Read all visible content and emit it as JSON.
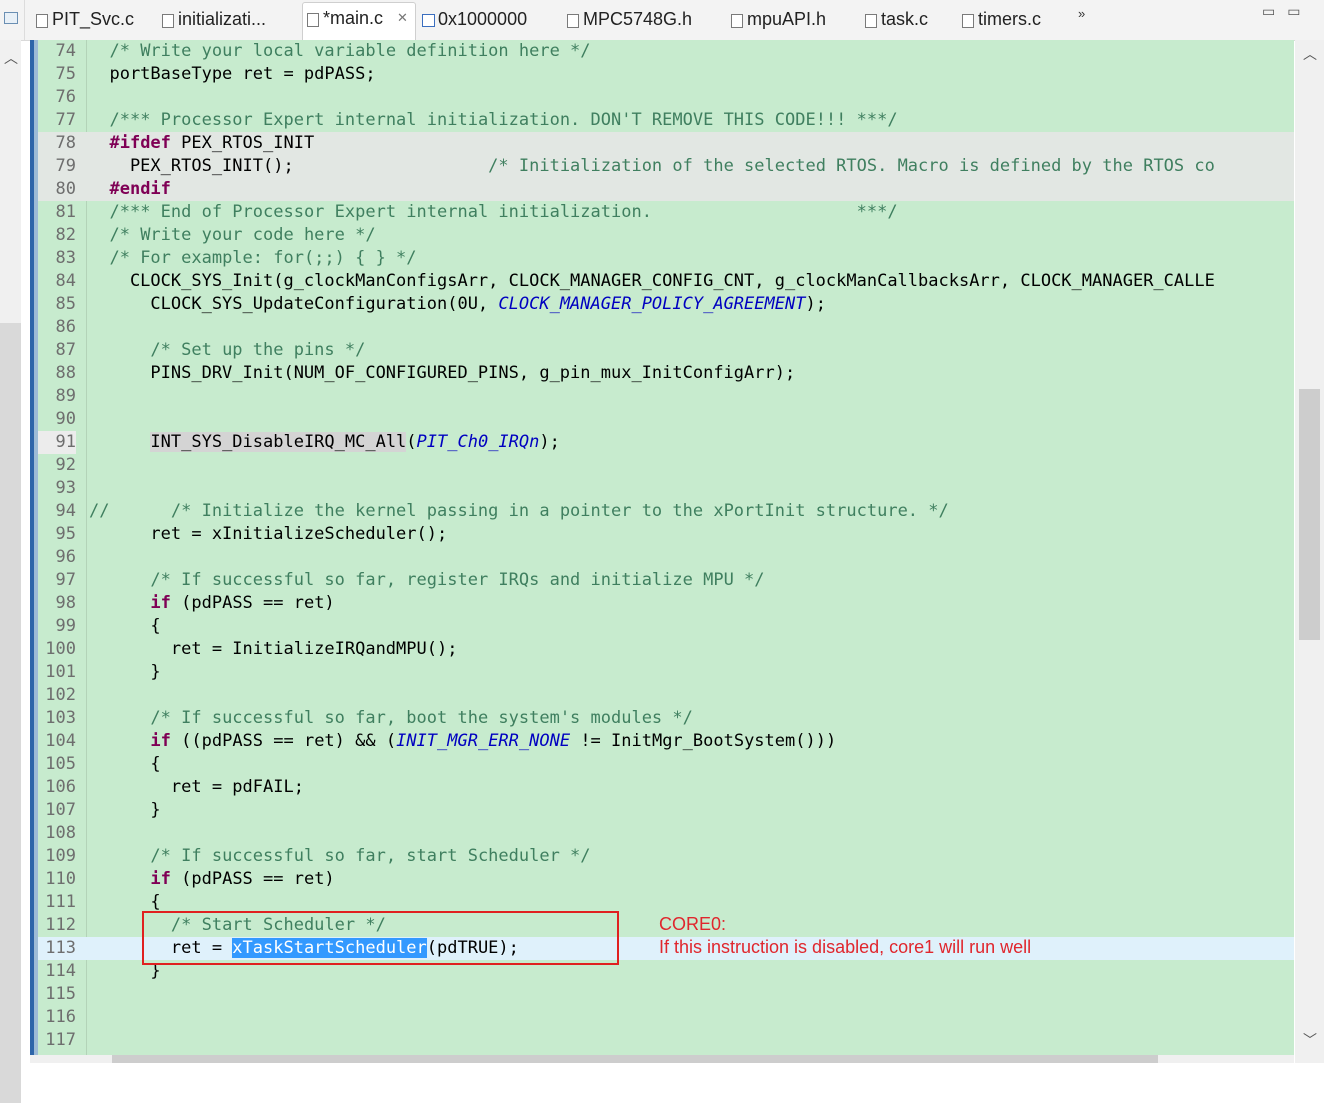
{
  "tabs": [
    {
      "label": "PIT_Svc.c",
      "icon": "c-file-icon",
      "active": false
    },
    {
      "label": "initializati...",
      "icon": "c-file-icon",
      "active": false
    },
    {
      "label": "*main.c",
      "icon": "c-file-icon",
      "active": true
    },
    {
      "label": "0x1000000",
      "icon": "memory-icon",
      "active": false
    },
    {
      "label": "MPC5748G.h",
      "icon": "h-file-icon",
      "active": false
    },
    {
      "label": "mpuAPI.h",
      "icon": "h-file-icon",
      "active": false
    },
    {
      "label": "task.c",
      "icon": "c-file-icon",
      "active": false
    },
    {
      "label": "timers.c",
      "icon": "c-file-icon",
      "active": false
    }
  ],
  "overflow_chevron": "»",
  "colors": {
    "editor_bg": "#c7ebce",
    "comment": "#3f7f5f",
    "keyword": "#7f0055",
    "enum": "#0000c0",
    "selection": "#3399ff",
    "annotation": "#e0262d"
  },
  "annotation": {
    "title": "CORE0:",
    "text": "If this instruction is disabled, core1 will run well"
  },
  "code_lines": [
    {
      "n": "74",
      "segs": [
        [
          "  ",
          ""
        ],
        [
          "/* Write your local variable definition here */",
          "com"
        ]
      ]
    },
    {
      "n": "75",
      "segs": [
        [
          "  portBaseType ret = pdPASS;",
          ""
        ]
      ]
    },
    {
      "n": "76",
      "segs": [
        [
          "",
          ""
        ]
      ]
    },
    {
      "n": "77",
      "segs": [
        [
          "  ",
          ""
        ],
        [
          "/*** Processor Expert internal initialization. DON'T REMOVE THIS CODE!!! ***/",
          "com"
        ]
      ]
    },
    {
      "n": "78",
      "hl": true,
      "segs": [
        [
          "  ",
          ""
        ],
        [
          "#ifdef",
          "kw"
        ],
        [
          " PEX_RTOS_INIT",
          ""
        ]
      ]
    },
    {
      "n": "79",
      "hl": true,
      "segs": [
        [
          "    PEX_RTOS_INIT();                   ",
          ""
        ],
        [
          "/* Initialization of the selected RTOS. Macro is defined by the RTOS co",
          "com"
        ]
      ]
    },
    {
      "n": "80",
      "hl": true,
      "segs": [
        [
          "  ",
          ""
        ],
        [
          "#endif",
          "kw"
        ]
      ]
    },
    {
      "n": "81",
      "segs": [
        [
          "  ",
          ""
        ],
        [
          "/*** End of Processor Expert internal initialization.                    ***/",
          "com"
        ]
      ]
    },
    {
      "n": "82",
      "segs": [
        [
          "  ",
          ""
        ],
        [
          "/* Write your code here */",
          "com"
        ]
      ]
    },
    {
      "n": "83",
      "segs": [
        [
          "  ",
          ""
        ],
        [
          "/* For example: for(;;) { } */",
          "com"
        ]
      ]
    },
    {
      "n": "84",
      "segs": [
        [
          "    CLOCK_SYS_Init(g_clockManConfigsArr, CLOCK_MANAGER_CONFIG_CNT, g_clockManCallbacksArr, CLOCK_MANAGER_CALLE",
          ""
        ]
      ]
    },
    {
      "n": "85",
      "segs": [
        [
          "      CLOCK_SYS_UpdateConfiguration(0U, ",
          ""
        ],
        [
          "CLOCK_MANAGER_POLICY_AGREEMENT",
          "en"
        ],
        [
          ");",
          ""
        ]
      ]
    },
    {
      "n": "86",
      "segs": [
        [
          "",
          ""
        ]
      ]
    },
    {
      "n": "87",
      "segs": [
        [
          "      ",
          ""
        ],
        [
          "/* Set up the pins */",
          "com"
        ]
      ]
    },
    {
      "n": "88",
      "segs": [
        [
          "      PINS_DRV_Init(NUM_OF_CONFIGURED_PINS, g_pin_mux_InitConfigArr);",
          ""
        ]
      ]
    },
    {
      "n": "89",
      "segs": [
        [
          "",
          ""
        ]
      ]
    },
    {
      "n": "90",
      "segs": [
        [
          "",
          ""
        ]
      ]
    },
    {
      "n": "91",
      "lnsel": true,
      "segs": [
        [
          "      ",
          ""
        ],
        [
          "INT_SYS_DisableIRQ_MC_All",
          "mark"
        ],
        [
          "(",
          ""
        ],
        [
          "PIT_Ch0_IRQn",
          "en"
        ],
        [
          ");",
          ""
        ]
      ]
    },
    {
      "n": "92",
      "segs": [
        [
          "",
          ""
        ]
      ]
    },
    {
      "n": "93",
      "segs": [
        [
          "",
          ""
        ]
      ]
    },
    {
      "n": "94",
      "segs": [
        [
          "//      ",
          "com"
        ],
        [
          "/* Initialize the kernel passing in a pointer to the xPortInit structure. */",
          "com"
        ]
      ]
    },
    {
      "n": "95",
      "segs": [
        [
          "      ret = xInitializeScheduler();",
          ""
        ]
      ]
    },
    {
      "n": "96",
      "segs": [
        [
          "",
          ""
        ]
      ]
    },
    {
      "n": "97",
      "segs": [
        [
          "      ",
          ""
        ],
        [
          "/* If successful so far, register IRQs and initialize MPU */",
          "com"
        ]
      ]
    },
    {
      "n": "98",
      "segs": [
        [
          "      ",
          ""
        ],
        [
          "if",
          "kw"
        ],
        [
          " (pdPASS == ret)",
          ""
        ]
      ]
    },
    {
      "n": "99",
      "segs": [
        [
          "      {",
          ""
        ]
      ]
    },
    {
      "n": "100",
      "segs": [
        [
          "        ret = InitializeIRQandMPU();",
          ""
        ]
      ]
    },
    {
      "n": "101",
      "segs": [
        [
          "      }",
          ""
        ]
      ]
    },
    {
      "n": "102",
      "segs": [
        [
          "",
          ""
        ]
      ]
    },
    {
      "n": "103",
      "segs": [
        [
          "      ",
          ""
        ],
        [
          "/* If successful so far, boot the system's modules */",
          "com"
        ]
      ]
    },
    {
      "n": "104",
      "segs": [
        [
          "      ",
          ""
        ],
        [
          "if",
          "kw"
        ],
        [
          " ((pdPASS == ret) && (",
          ""
        ],
        [
          "INIT_MGR_ERR_NONE",
          "en"
        ],
        [
          " != InitMgr_BootSystem()))",
          ""
        ]
      ]
    },
    {
      "n": "105",
      "segs": [
        [
          "      {",
          ""
        ]
      ]
    },
    {
      "n": "106",
      "segs": [
        [
          "        ret = pdFAIL;",
          ""
        ]
      ]
    },
    {
      "n": "107",
      "segs": [
        [
          "      }",
          ""
        ]
      ]
    },
    {
      "n": "108",
      "segs": [
        [
          "",
          ""
        ]
      ]
    },
    {
      "n": "109",
      "segs": [
        [
          "      ",
          ""
        ],
        [
          "/* If successful so far, start Scheduler */",
          "com"
        ]
      ]
    },
    {
      "n": "110",
      "segs": [
        [
          "      ",
          ""
        ],
        [
          "if",
          "kw"
        ],
        [
          " (pdPASS == ret)",
          ""
        ]
      ]
    },
    {
      "n": "111",
      "segs": [
        [
          "      {",
          ""
        ]
      ]
    },
    {
      "n": "112",
      "segs": [
        [
          "        ",
          ""
        ],
        [
          "/* Start Scheduler */",
          "com"
        ]
      ]
    },
    {
      "n": "113",
      "cur": true,
      "segs": [
        [
          "        ret = ",
          ""
        ],
        [
          "xTaskStartScheduler",
          "sel"
        ],
        [
          "(pdTRUE);",
          ""
        ]
      ]
    },
    {
      "n": "114",
      "segs": [
        [
          "      }",
          ""
        ]
      ]
    },
    {
      "n": "115",
      "segs": [
        [
          "",
          ""
        ]
      ]
    },
    {
      "n": "116",
      "segs": [
        [
          "",
          ""
        ]
      ]
    },
    {
      "n": "117",
      "segs": [
        [
          "",
          ""
        ]
      ]
    }
  ]
}
